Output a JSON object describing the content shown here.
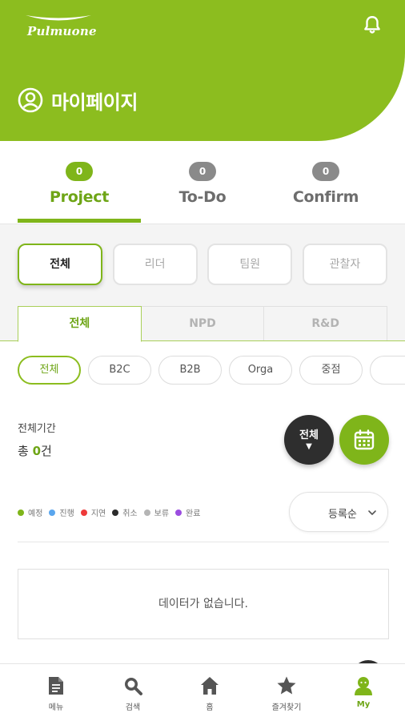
{
  "header": {
    "logo_text": "Pulmuone",
    "title": "마이페이지",
    "bg_color": "#8cbd1f"
  },
  "main_tabs": [
    {
      "label": "Project",
      "count": "0",
      "active": true
    },
    {
      "label": "To-Do",
      "count": "0",
      "active": false
    },
    {
      "label": "Confirm",
      "count": "0",
      "active": false
    }
  ],
  "roles": [
    {
      "label": "전체",
      "active": true
    },
    {
      "label": "리더",
      "active": false
    },
    {
      "label": "팀원",
      "active": false
    },
    {
      "label": "관찰자",
      "active": false
    }
  ],
  "segments": [
    {
      "label": "전체",
      "active": true
    },
    {
      "label": "NPD",
      "active": false
    },
    {
      "label": "R&D",
      "active": false
    }
  ],
  "chips": [
    {
      "label": "전체",
      "active": true
    },
    {
      "label": "B2C",
      "active": false
    },
    {
      "label": "B2B",
      "active": false
    },
    {
      "label": "Orga",
      "active": false
    },
    {
      "label": "중점",
      "active": false
    }
  ],
  "period": {
    "label": "전체기간",
    "total_prefix": "총 ",
    "total_count": "0",
    "total_suffix": "건"
  },
  "filter_button": {
    "label": "전체",
    "arrow": "▼"
  },
  "legend": [
    {
      "label": "예정",
      "color": "#7fb51a"
    },
    {
      "label": "진행",
      "color": "#5aa6ee"
    },
    {
      "label": "지연",
      "color": "#ee3a3a"
    },
    {
      "label": "취소",
      "color": "#2b2b2b"
    },
    {
      "label": "보류",
      "color": "#b5b5b5"
    },
    {
      "label": "완료",
      "color": "#9b4de0"
    }
  ],
  "sort": {
    "label": "등록순"
  },
  "empty_message": "데이터가 없습니다.",
  "bottom_nav": [
    {
      "label": "메뉴",
      "icon": "document-icon",
      "active": false
    },
    {
      "label": "검색",
      "icon": "search-icon",
      "active": false
    },
    {
      "label": "홈",
      "icon": "home-icon",
      "active": false
    },
    {
      "label": "즐겨찾기",
      "icon": "star-icon",
      "active": false
    },
    {
      "label": "My",
      "icon": "user-icon",
      "active": true
    }
  ]
}
